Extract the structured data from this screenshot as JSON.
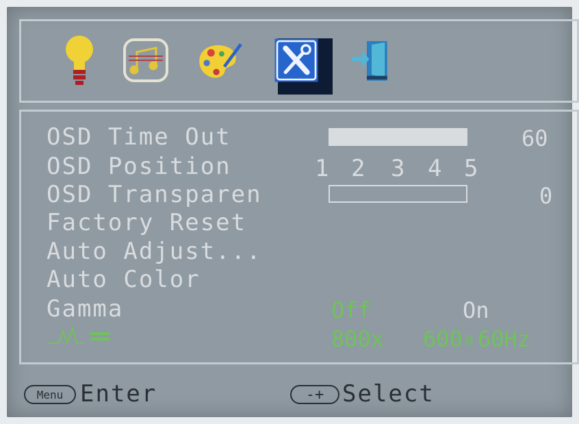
{
  "osd": {
    "rows": {
      "osd_time_out": {
        "label": "OSD Time Out",
        "value": "60",
        "level": 1.0
      },
      "osd_position": {
        "label": "OSD Position",
        "options": [
          "1",
          "2",
          "3",
          "4",
          "5"
        ],
        "selected": "3"
      },
      "osd_transparency": {
        "label": "OSD Transparen",
        "value": "0",
        "level": 0.0
      },
      "factory_reset": {
        "label": "Factory Reset"
      },
      "auto_adjust": {
        "label": "Auto Adjust..."
      },
      "auto_color": {
        "label": "Auto Color"
      },
      "gamma": {
        "label": "Gamma",
        "off": "Off",
        "on": "On",
        "selected": "Off"
      }
    },
    "resolution": {
      "width": "800x",
      "height": "600",
      "at": "@",
      "refresh": "60Hz"
    },
    "footer": {
      "menu_key": "Menu",
      "enter": "Enter",
      "select_key": "-+",
      "select": "Select"
    },
    "colors": {
      "selected": "#6fc25c",
      "text": "#d9dcdf",
      "background": "#8f9aa2"
    },
    "icons": [
      "brightness-bulb-icon",
      "audio-music-icon",
      "color-palette-icon",
      "settings-tools-icon",
      "exit-door-icon"
    ],
    "selected_tab": "settings-tools-icon"
  }
}
